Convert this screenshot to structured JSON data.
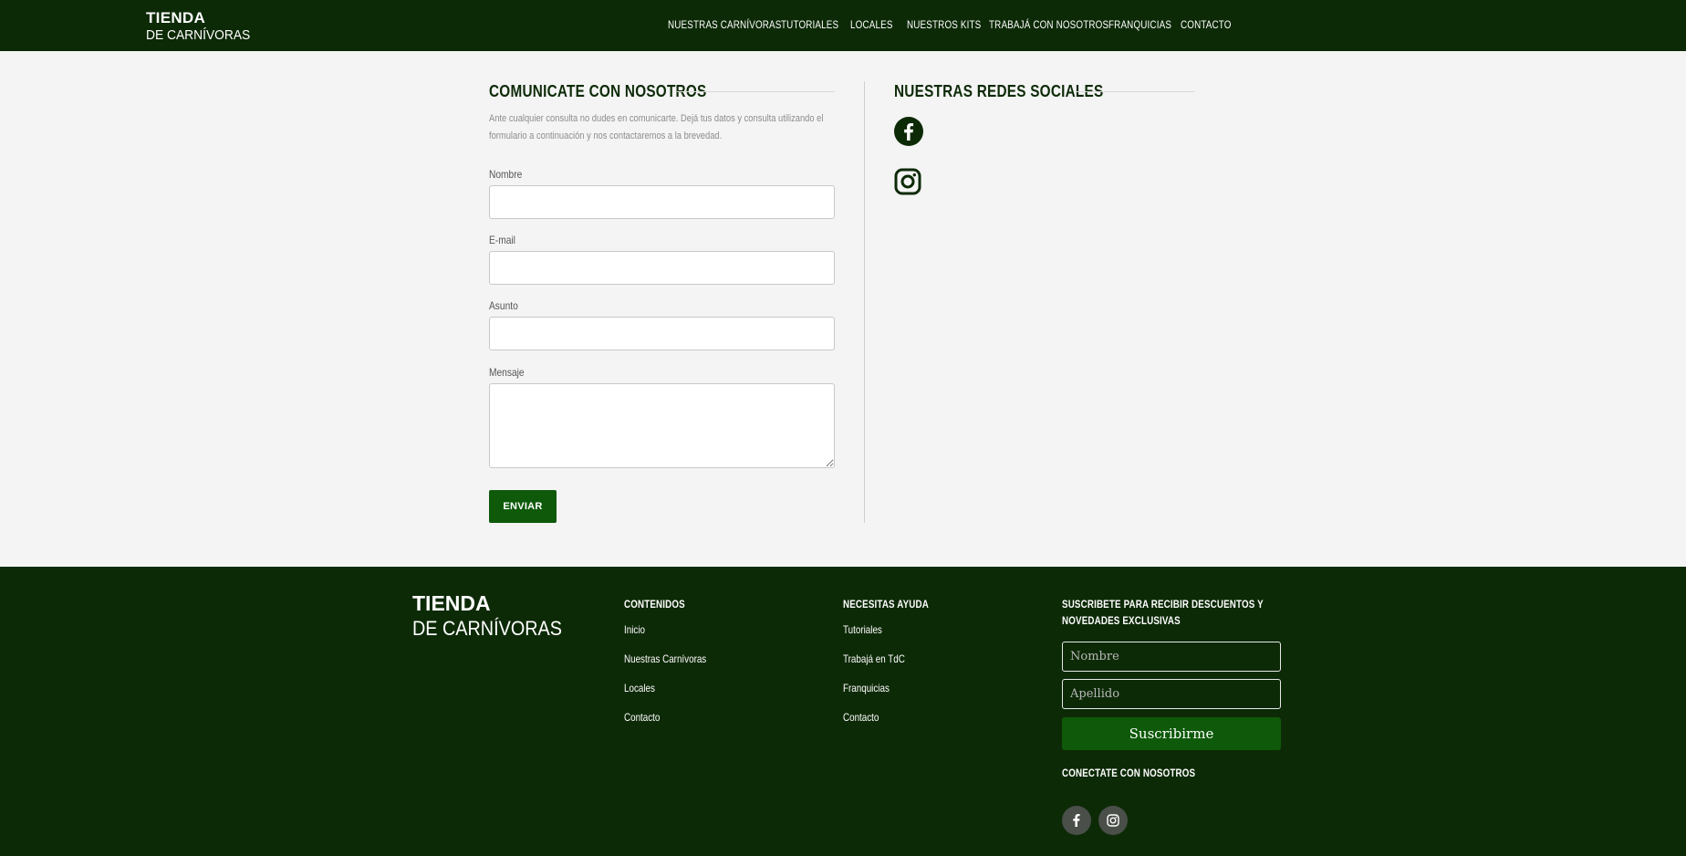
{
  "header": {
    "logo_line1": "TIENDA",
    "logo_line2": "DE CARNÍVORAS",
    "nav": [
      "NUESTRAS CARNÍVORAS",
      "TUTORIALES",
      "LOCALES",
      "NUESTROS KITS",
      "TRABAJÁ CON NOSOTROS",
      "FRANQUICIAS",
      "CONTACTO"
    ]
  },
  "contact": {
    "title": "COMUNICATE CON NOSOTROS",
    "intro": "Ante cualquier consulta no dudes en comunicarte. Dejá tus datos y consulta utilizando el formulario a continuación y nos contactaremos a la brevedad.",
    "fields": {
      "name_label": "Nombre",
      "email_label": "E-mail",
      "subject_label": "Asunto",
      "message_label": "Mensaje"
    },
    "send_label": "ENVIAR"
  },
  "social": {
    "title": "NUESTRAS REDES SOCIALES",
    "icons": [
      "facebook-icon",
      "instagram-icon"
    ]
  },
  "footer": {
    "logo_line1": "TIENDA",
    "logo_line2": "DE CARNÍVORAS",
    "contents": {
      "heading": "CONTENIDOS",
      "links": [
        "Inicio",
        "Nuestras Carnívoras",
        "Locales",
        "Contacto"
      ]
    },
    "help": {
      "heading": "NECESITAS AYUDA",
      "links": [
        "Tutoriales",
        "Trabajá en TdC",
        "Franquicias",
        "Contacto"
      ]
    },
    "subscribe": {
      "heading": "SUSCRIBETE PARA RECIBIR DESCUENTOS Y NOVEDADES EXCLUSIVAS",
      "name_placeholder": "Nombre",
      "lastname_placeholder": "Apellido",
      "button_label": "Suscribirme"
    },
    "connect_heading": "CONECTATE CON NOSOTROS"
  },
  "colors": {
    "brand_dark": "#0d2a07",
    "button_green": "#0e5a0a",
    "page_bg": "#f4f4f4"
  }
}
